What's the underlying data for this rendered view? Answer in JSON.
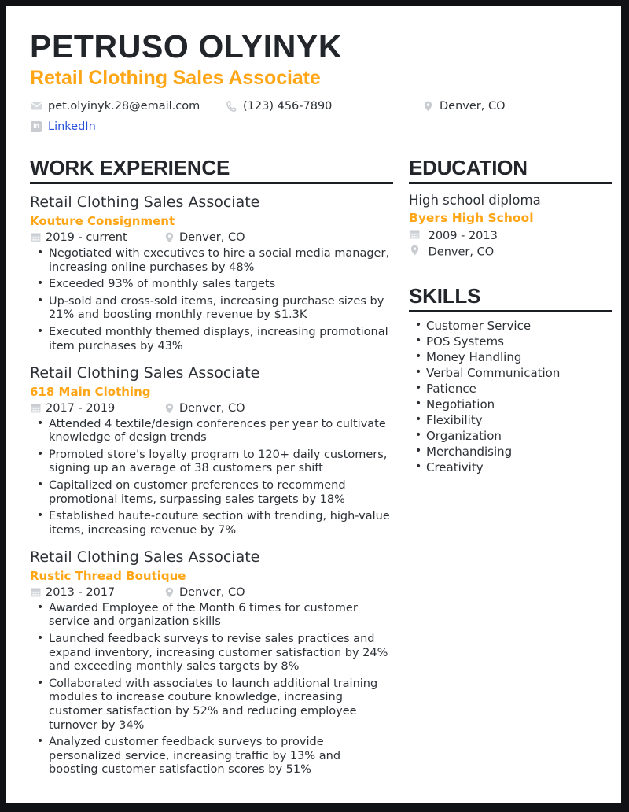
{
  "header": {
    "name": "PETRUSO OLYINYK",
    "job_title": "Retail Clothing Sales Associate",
    "email": "pet.olyinyk.28@email.com",
    "phone": "(123) 456-7890",
    "location": "Denver, CO",
    "linkedin_label": "LinkedIn",
    "linkedin_badge": "in"
  },
  "colors": {
    "accent_orange": "#ffa617",
    "text_dark": "#2d3136",
    "heading_dark": "#22262b",
    "link_blue": "#2750d8",
    "icon_gray": "#c9ccd1",
    "frame_black": "#0f1115"
  },
  "work": {
    "section_title": "WORK EXPERIENCE",
    "entries": [
      {
        "title": "Retail Clothing Sales Associate",
        "org": "Kouture Consignment",
        "dates": "2019 - current",
        "location": "Denver, CO",
        "bullets": [
          "Negotiated with executives to hire a social media manager, increasing online purchases by 48%",
          "Exceeded 93% of monthly sales targets",
          "Up-sold and cross-sold items, increasing purchase sizes by 21% and boosting monthly revenue by $1.3K",
          "Executed monthly themed displays, increasing promotional item purchases by 43%"
        ]
      },
      {
        "title": "Retail Clothing Sales Associate",
        "org": "618 Main Clothing",
        "dates": "2017 - 2019",
        "location": "Denver, CO",
        "bullets": [
          "Attended 4 textile/design conferences per year to cultivate knowledge of design trends",
          "Promoted store's loyalty program to 120+ daily customers, signing up an average of 38 customers per shift",
          "Capitalized on customer preferences to recommend promotional items, surpassing sales targets by 18%",
          "Established haute-couture section with trending, high-value items, increasing revenue by 7%"
        ]
      },
      {
        "title": "Retail Clothing Sales Associate",
        "org": "Rustic Thread Boutique",
        "dates": "2013 - 2017",
        "location": "Denver, CO",
        "bullets": [
          "Awarded Employee of the Month 6 times for customer service and organization skills",
          "Launched feedback surveys to revise sales practices and expand inventory, increasing customer satisfaction by 24% and exceeding monthly sales targets by 8%",
          "Collaborated with associates to launch additional training modules to increase couture knowledge, increasing customer satisfaction by 52% and reducing employee turnover by 34%",
          "Analyzed customer feedback surveys to provide personalized service, increasing traffic by 13% and boosting customer satisfaction scores by 51%"
        ]
      }
    ]
  },
  "education": {
    "section_title": "EDUCATION",
    "degree": "High school diploma",
    "school": "Byers High School",
    "dates": "2009 - 2013",
    "location": "Denver, CO"
  },
  "skills": {
    "section_title": "SKILLS",
    "items": [
      "Customer Service",
      "POS Systems",
      "Money Handling",
      "Verbal Communication",
      "Patience",
      "Negotiation",
      "Flexibility",
      "Organization",
      "Merchandising",
      "Creativity"
    ]
  },
  "icons": {
    "email": "envelope-icon",
    "phone": "phone-icon",
    "location": "map-pin-icon",
    "linkedin": "linkedin-icon",
    "calendar": "calendar-icon"
  }
}
